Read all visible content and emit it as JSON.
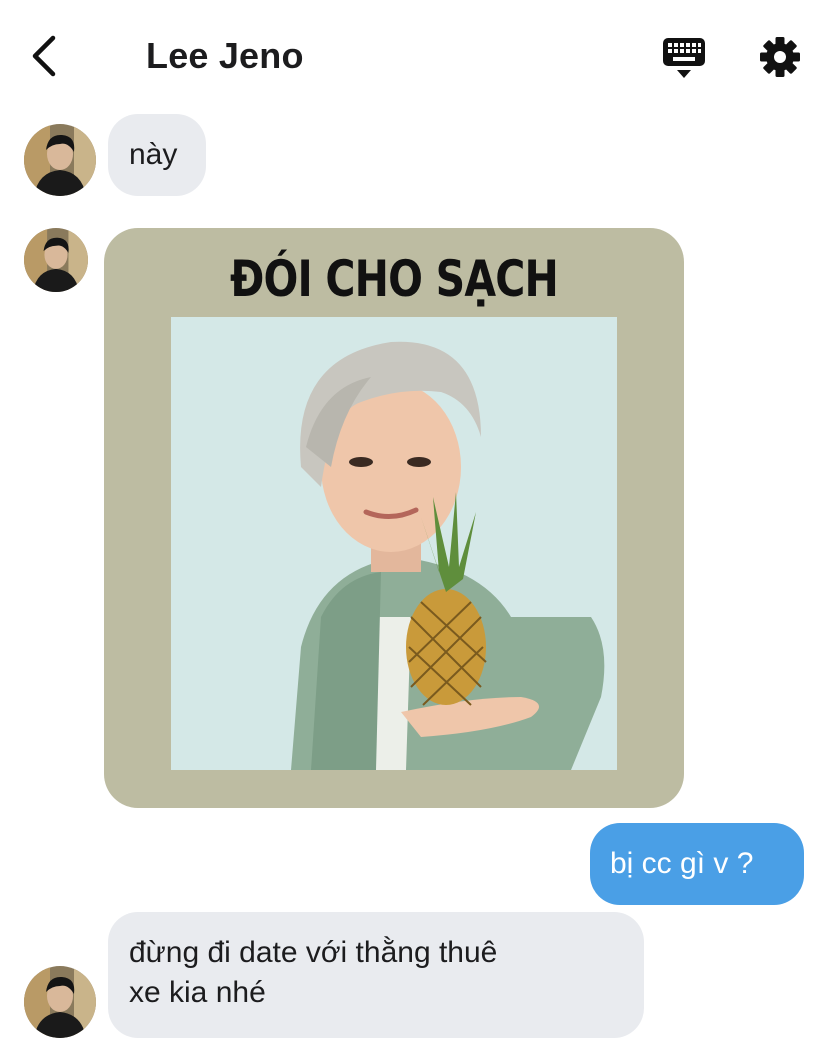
{
  "header": {
    "title": "Lee Jeno",
    "icons": [
      "chevron-left-icon",
      "keyboard-icon",
      "gear-icon"
    ]
  },
  "messages": [
    {
      "direction": "incoming",
      "type": "text",
      "text": "này"
    },
    {
      "direction": "incoming",
      "type": "image",
      "caption": "ĐÓI CHO SẠCH"
    },
    {
      "direction": "outgoing",
      "type": "text",
      "text": "bị cc gì v ?"
    },
    {
      "direction": "incoming",
      "type": "text",
      "text_lines": [
        "đừng đi date với thằng thuê",
        "xe kia nhé"
      ]
    }
  ],
  "colors": {
    "incoming_bubble": "#e9ebef",
    "outgoing_bubble": "#4a9fe6",
    "image_background": "#bdbca2",
    "text_primary": "#1c1c1e"
  }
}
